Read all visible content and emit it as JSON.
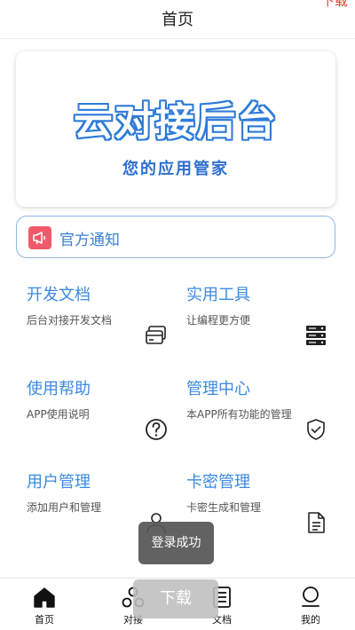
{
  "header": {
    "title": "首页",
    "right_action": "下载"
  },
  "banner": {
    "brand": "云对接后台",
    "slogan": "您的应用管家"
  },
  "notice": {
    "icon": "megaphone-icon",
    "label": "官方通知"
  },
  "cards": [
    {
      "title": "开发文档",
      "desc": "后台对接开发文档",
      "icon": "card-stack-icon"
    },
    {
      "title": "实用工具",
      "desc": "让编程更方便",
      "icon": "server-icon"
    },
    {
      "title": "使用帮助",
      "desc": "APP使用说明",
      "icon": "help-icon"
    },
    {
      "title": "管理中心",
      "desc": "本APP所有功能的管理",
      "icon": "shield-check-icon"
    },
    {
      "title": "用户管理",
      "desc": "添加用户和管理",
      "icon": "user-icon"
    },
    {
      "title": "卡密管理",
      "desc": "卡密生成和管理",
      "icon": "document-icon"
    }
  ],
  "toast": {
    "text": "登录成功"
  },
  "overlay_button": {
    "label": "下载"
  },
  "tabbar": {
    "items": [
      {
        "label": "首页",
        "icon": "home-icon"
      },
      {
        "label": "对接",
        "icon": "connect-icon"
      },
      {
        "label": "文档",
        "icon": "doc-list-icon"
      },
      {
        "label": "我的",
        "icon": "profile-icon"
      }
    ]
  },
  "colors": {
    "accent": "#3a8ae0",
    "notice_icon_bg": "#f05a6a",
    "notice_border": "#8fb6ea",
    "header_action": "#e6453b"
  }
}
